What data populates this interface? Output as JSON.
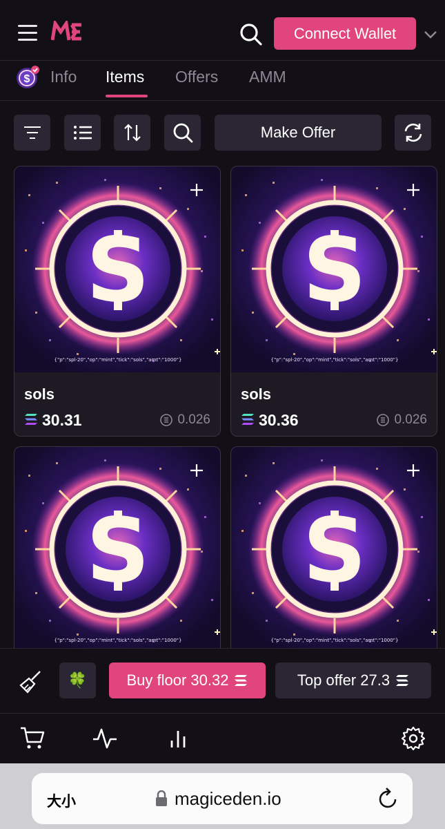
{
  "header": {
    "connect_label": "Connect Wallet",
    "colors": {
      "accent": "#e0457b",
      "background": "#120f17",
      "surface": "#2b2633"
    }
  },
  "tabs": [
    {
      "label": "Info",
      "active": false
    },
    {
      "label": "Items",
      "active": true
    },
    {
      "label": "Offers",
      "active": false
    },
    {
      "label": "AMM",
      "active": false
    }
  ],
  "toolbar": {
    "icons": [
      "filter-icon",
      "list-view-icon",
      "sort-icon",
      "search-icon",
      "refresh-icon"
    ],
    "make_offer_label": "Make Offer"
  },
  "items": [
    {
      "name": "sols",
      "price": "30.31",
      "fee": "0.026",
      "inscription": "{\"p\":\"spl-20\",\"op\":\"mint\",\"tick\":\"sols\",\"amt\":\"1000\"}"
    },
    {
      "name": "sols",
      "price": "30.36",
      "fee": "0.026",
      "inscription": "{\"p\":\"spl-20\",\"op\":\"mint\",\"tick\":\"sols\",\"amt\":\"1000\"}"
    },
    {
      "name": "",
      "price": "",
      "fee": "",
      "inscription": "{\"p\":\"spl-20\",\"op\":\"mint\",\"tick\":\"sols\",\"amt\":\"1000\"}"
    },
    {
      "name": "",
      "price": "",
      "fee": "",
      "inscription": "{\"p\":\"spl-20\",\"op\":\"mint\",\"tick\":\"sols\",\"amt\":\"1000\"}"
    }
  ],
  "actions": {
    "buy_floor_label": "Buy floor 30.32",
    "top_offer_label": "Top offer 27.3"
  },
  "bottom_nav": [
    "cart-icon",
    "activity-icon",
    "analytics-icon",
    "settings-icon"
  ],
  "browser": {
    "text_size_label": "大小",
    "url": "magiceden.io"
  }
}
